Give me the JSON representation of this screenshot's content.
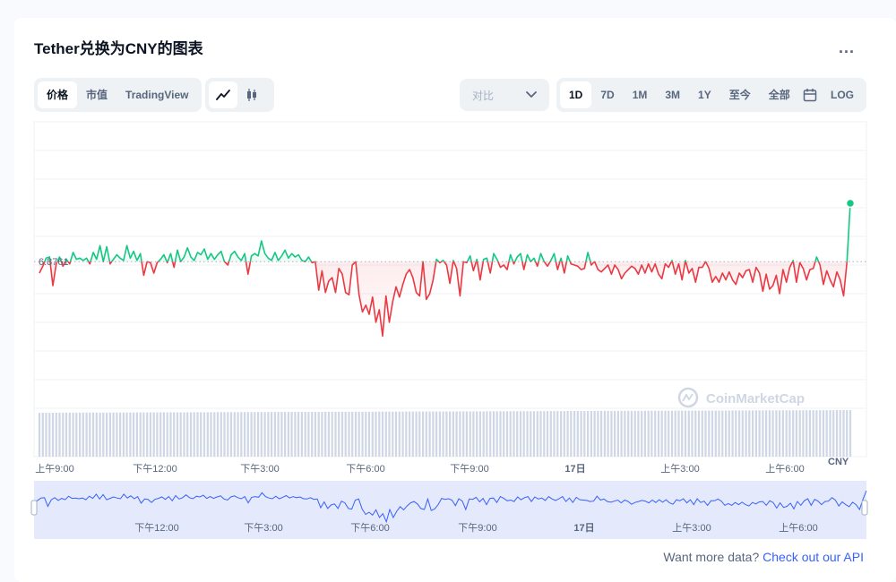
{
  "title": "Tether兑换为CNY的图表",
  "more_label": "...",
  "view_tabs": [
    {
      "label": "价格",
      "active": true
    },
    {
      "label": "市值",
      "active": false
    },
    {
      "label": "TradingView",
      "active": false
    }
  ],
  "chart_types": [
    {
      "icon": "line-chart-icon",
      "active": true
    },
    {
      "icon": "candlestick-icon",
      "active": false
    }
  ],
  "compare": {
    "label": "对比",
    "icon": "chevron-down-icon"
  },
  "ranges": [
    {
      "label": "1D",
      "active": true
    },
    {
      "label": "7D",
      "active": false
    },
    {
      "label": "1M",
      "active": false
    },
    {
      "label": "3M",
      "active": false
    },
    {
      "label": "1Y",
      "active": false
    },
    {
      "label": "至今",
      "active": false
    },
    {
      "label": "全部",
      "active": false
    }
  ],
  "calendar_icon": "calendar-icon",
  "log_label": "LOG",
  "watermark": "CoinMarketCap",
  "colors": {
    "up": "#16c784",
    "down": "#ea3943",
    "volume": "#cfd6e4",
    "navigator": "#e4e9fb",
    "navigator_line": "#3861fb",
    "accent": "#3861fb"
  },
  "footer": {
    "text": "Want more data?",
    "link": "Check out our API"
  },
  "chart_data": {
    "type": "line",
    "title": "",
    "xlabel": "",
    "ylabel": "",
    "currency_label": "CNY",
    "reference_line": {
      "value": 6.8761,
      "label": "6.8761"
    },
    "ylim": [
      6.8636,
      6.888
    ],
    "x_ticks": [
      "上午9:00",
      "下午12:00",
      "下午3:00",
      "下午6:00",
      "下午9:00",
      "17日",
      "上午3:00",
      "上午6:00"
    ],
    "navigator_ticks": [
      "下午12:00",
      "下午3:00",
      "下午6:00",
      "下午9:00",
      "17日",
      "上午3:00",
      "上午6:00"
    ],
    "grid": true,
    "series": [
      {
        "values": [
          6.8751,
          6.8757,
          6.8764,
          6.8765,
          6.874,
          6.8759,
          6.8765,
          6.8757,
          6.8763,
          6.8759,
          6.8769,
          6.8763,
          6.8764,
          6.8762,
          6.8764,
          6.8759,
          6.8769,
          6.8763,
          6.8775,
          6.8761,
          6.8774,
          6.8759,
          6.8763,
          6.8767,
          6.8764,
          6.8762,
          6.8775,
          6.8764,
          6.877,
          6.8762,
          6.8768,
          6.8749,
          6.8761,
          6.876,
          6.8751,
          6.876,
          6.8763,
          6.8767,
          6.876,
          6.8768,
          6.8756,
          6.8771,
          6.8761,
          6.8765,
          6.8773,
          6.8765,
          6.8762,
          6.8769,
          6.8767,
          6.8772,
          6.8763,
          6.8768,
          6.8763,
          6.8767,
          6.877,
          6.8761,
          6.8758,
          6.8767,
          6.877,
          6.8765,
          6.8762,
          6.8768,
          6.875,
          6.8766,
          6.8768,
          6.8766,
          6.8779,
          6.8768,
          6.8764,
          6.8762,
          6.8769,
          6.8762,
          6.8766,
          6.8771,
          6.8764,
          6.8768,
          6.8765,
          6.8767,
          6.8762,
          6.8761,
          6.8765,
          6.876,
          6.8761,
          6.8736,
          6.8753,
          6.8734,
          6.8744,
          6.8747,
          6.8734,
          6.8755,
          6.875,
          6.8734,
          6.8732,
          6.8758,
          6.8761,
          6.8732,
          6.8717,
          6.8723,
          6.8715,
          6.873,
          6.8708,
          6.8719,
          6.8696,
          6.8731,
          6.8708,
          6.8726,
          6.8739,
          6.873,
          6.8741,
          6.875,
          6.8754,
          6.8747,
          6.8734,
          6.8731,
          6.8761,
          6.8728,
          6.8733,
          6.8745,
          6.8763,
          6.876,
          6.8762,
          6.8758,
          6.8742,
          6.8762,
          6.8755,
          6.8731,
          6.8761,
          6.876,
          6.8766,
          6.8753,
          6.8763,
          6.8745,
          6.8763,
          6.8764,
          6.8751,
          6.8768,
          6.8763,
          6.8756,
          6.8758,
          6.8754,
          6.8767,
          6.8759,
          6.8765,
          6.8768,
          6.8754,
          6.8767,
          6.8761,
          6.8764,
          6.8757,
          6.8768,
          6.8761,
          6.8757,
          6.8762,
          6.8768,
          6.8754,
          6.8764,
          6.8751,
          6.8766,
          6.8759,
          6.8758,
          6.8757,
          6.8754,
          6.8755,
          6.8769,
          6.8758,
          6.8761,
          6.8754,
          6.8752,
          6.8755,
          6.8758,
          6.875,
          6.8758,
          6.8754,
          6.8746,
          6.8751,
          6.8754,
          6.8757,
          6.8755,
          6.875,
          6.8758,
          6.8751,
          6.8759,
          6.8752,
          6.8759,
          6.875,
          6.8746,
          6.8759,
          6.8756,
          6.8762,
          6.875,
          6.8759,
          6.8745,
          6.8762,
          6.8751,
          6.8755,
          6.8743,
          6.8756,
          6.8756,
          6.8761,
          6.8755,
          6.8743,
          6.8748,
          6.8743,
          6.8751,
          6.8745,
          6.8752,
          6.8745,
          6.8741,
          6.8751,
          6.8747,
          6.8753,
          6.8754,
          6.8743,
          6.8756,
          6.8751,
          6.8735,
          6.875,
          6.8737,
          6.874,
          6.8749,
          6.8733,
          6.8754,
          6.8743,
          6.8756,
          6.8762,
          6.8743,
          6.876,
          6.8755,
          6.8745,
          6.8754,
          6.8755,
          6.8765,
          6.8758,
          6.8741,
          6.8753,
          6.8745,
          6.8739,
          6.8752,
          6.8745,
          6.8731,
          6.876,
          6.8812
        ]
      }
    ]
  }
}
